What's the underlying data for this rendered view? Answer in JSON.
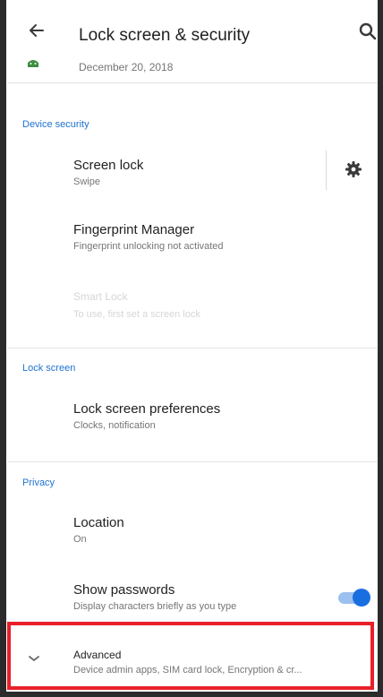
{
  "toolbar": {
    "title": "Lock screen & security",
    "back_icon": "arrow-back-icon",
    "search_icon": "search-icon"
  },
  "top_item": {
    "text": "December 20, 2018",
    "icon": "android-icon"
  },
  "sections": {
    "device_security": "Device security",
    "lock_screen": "Lock screen",
    "privacy": "Privacy"
  },
  "items": {
    "screen_lock": {
      "title": "Screen lock",
      "subtitle": "Swipe",
      "settings_icon": "gear-icon"
    },
    "fingerprint": {
      "title": "Fingerprint Manager",
      "subtitle": "Fingerprint unlocking not activated"
    },
    "smart_lock": {
      "title": "Smart Lock",
      "subtitle": "To use, first set a screen lock"
    },
    "lock_prefs": {
      "title": "Lock screen preferences",
      "subtitle": "Clocks, notification"
    },
    "location": {
      "title": "Location",
      "subtitle": "On"
    },
    "show_passwords": {
      "title": "Show passwords",
      "subtitle": "Display characters briefly as you type",
      "toggle_on": true
    },
    "advanced": {
      "title": "Advanced",
      "subtitle": "Device admin apps, SIM card lock, Encryption & cr...",
      "icon": "chevron-down-icon"
    }
  },
  "colors": {
    "accent": "#1a6fe0",
    "section": "#1e73d1",
    "highlight": "#e8202a"
  }
}
